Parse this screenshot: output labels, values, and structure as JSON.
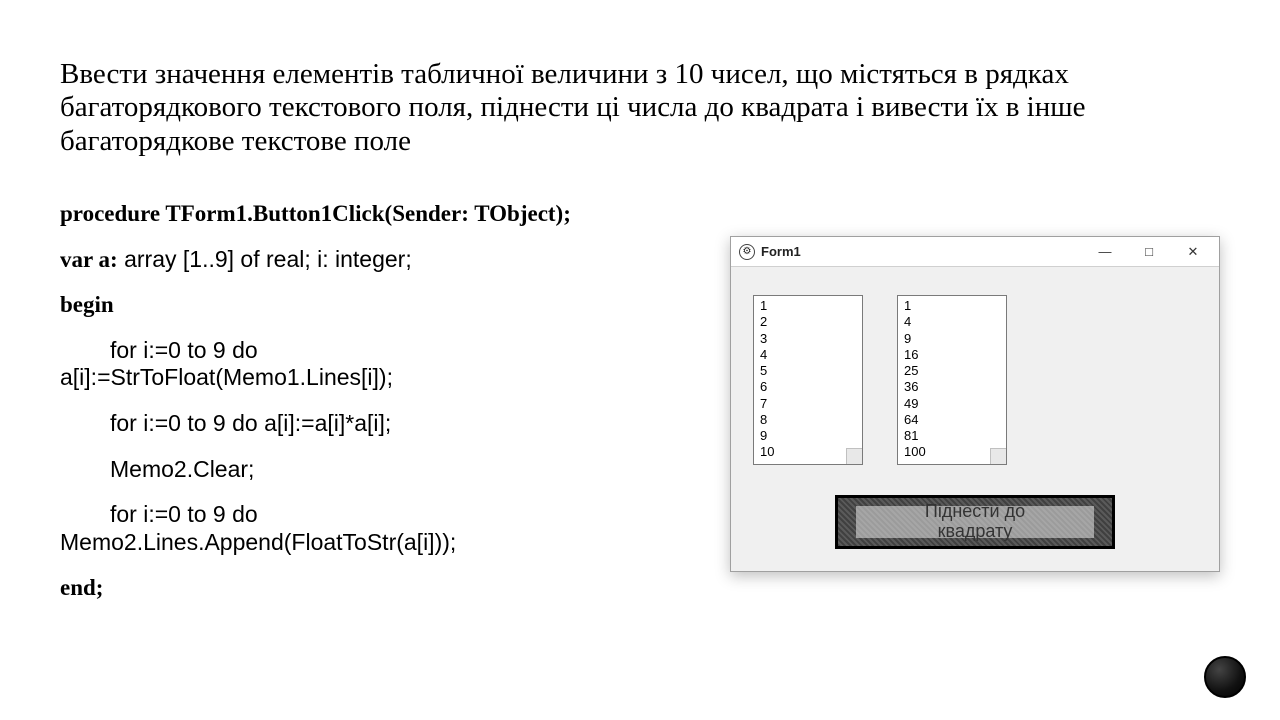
{
  "title_text": "Ввести значення елементів табличної величини з 10 чисел, що містяться в рядках багаторядкового текстового поля, піднести ці числа до квадрата і вивести їх в інше багаторядкове текстове поле",
  "code": {
    "l1_bold": "procedure TForm1.Button1Click(Sender: TObject);",
    "l2_bold": "var a:",
    "l2_sans": " array [1..9] of real; i: integer;",
    "l3_bold": "begin",
    "l4a_sans": "for i:=0 to 9 do",
    "l4b_sans": "a[i]:=StrToFloat(Memo1.Lines[i]);",
    "l5_sans": "for i:=0 to 9 do a[i]:=a[i]*a[i];",
    "l6_sans": "Memo2.Clear;",
    "l7a_sans": "for i:=0 to 9 do",
    "l7b_sans": "Memo2.Lines.Append(FloatToStr(a[i]));",
    "l8_bold": "end;"
  },
  "form": {
    "title": "Form1",
    "memo1": [
      "1",
      "2",
      "3",
      "4",
      "5",
      "6",
      "7",
      "8",
      "9",
      "10"
    ],
    "memo2": [
      "1",
      "4",
      "9",
      "16",
      "25",
      "36",
      "49",
      "64",
      "81",
      "100"
    ],
    "button_label": "Піднести до\nквадрату",
    "win": {
      "min": "—",
      "max": "□",
      "close": "✕"
    }
  }
}
